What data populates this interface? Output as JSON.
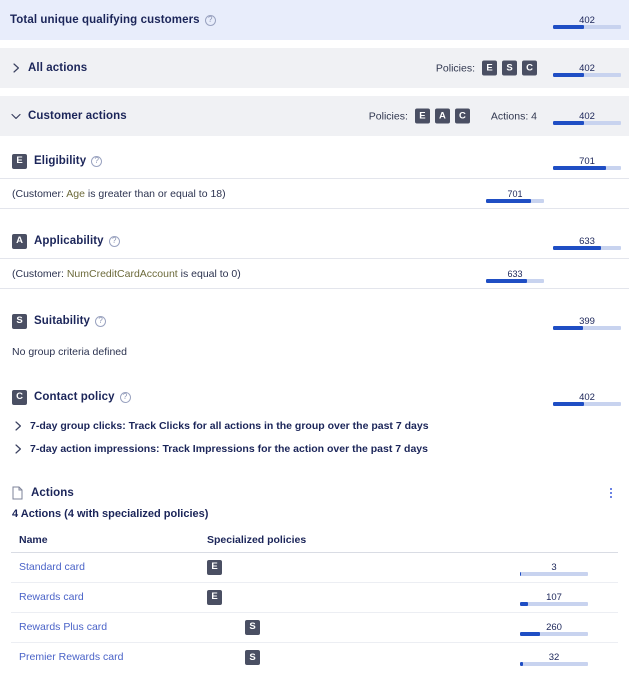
{
  "colors": {
    "accent": "#1f4ec4",
    "track": "#c8d3ef",
    "badge": "#4a4f63",
    "total_band": "#e8edfb",
    "gray_band": "#f0f1f4",
    "link": "#4a63c8"
  },
  "total": {
    "label": "Total unique qualifying customers",
    "help_icon": "question-circle-icon",
    "value": "402",
    "percent": 45
  },
  "all_actions": {
    "label": "All actions",
    "chevron": "chevron-right-icon",
    "policies_label": "Policies:",
    "badges": [
      "E",
      "S",
      "C"
    ],
    "value": "402",
    "percent": 45
  },
  "customer_actions": {
    "label": "Customer actions",
    "chevron": "chevron-down-icon",
    "policies_label": "Policies:",
    "badges": [
      "E",
      "A",
      "C"
    ],
    "actions_count": "Actions: 4",
    "value": "402",
    "percent": 45
  },
  "policy_sections": [
    {
      "badge": "E",
      "title": "Eligibility",
      "help_icon": "question-circle-icon",
      "value": "701",
      "percent": 78,
      "criteria": [
        {
          "text_pre": "(Customer: ",
          "text_hl": "Age",
          "text_post": " is greater than or equal to 18)",
          "value": "701",
          "percent": 78
        }
      ],
      "empty_text": ""
    },
    {
      "badge": "A",
      "title": "Applicability",
      "help_icon": "question-circle-icon",
      "value": "633",
      "percent": 70,
      "criteria": [
        {
          "text_pre": "(Customer: ",
          "text_hl": "NumCreditCardAccount",
          "text_post": " is equal to 0)",
          "value": "633",
          "percent": 70
        }
      ],
      "empty_text": ""
    },
    {
      "badge": "S",
      "title": "Suitability",
      "help_icon": "question-circle-icon",
      "value": "399",
      "percent": 44,
      "criteria": [],
      "empty_text": "No group criteria defined"
    }
  ],
  "contact_policy": {
    "badge": "C",
    "title": "Contact policy",
    "help_icon": "question-circle-icon",
    "value": "402",
    "percent": 45,
    "rows": [
      {
        "chevron": "chevron-right-icon",
        "text": "7-day group clicks: Track Clicks for all actions in the group over the past 7 days"
      },
      {
        "chevron": "chevron-right-icon",
        "text": "7-day action impressions: Track Impressions for the action over the past 7 days"
      }
    ]
  },
  "actions_panel": {
    "icon": "document-icon",
    "title": "Actions",
    "menu_icon": "kebab-menu-icon",
    "summary": "4 Actions (4 with specialized policies)",
    "columns": [
      "Name",
      "Specialized policies"
    ],
    "rows": [
      {
        "name": "Standard card",
        "policy": "E",
        "policy_indent": 0,
        "value": "3",
        "percent": 1
      },
      {
        "name": "Rewards card",
        "policy": "E",
        "policy_indent": 0,
        "value": "107",
        "percent": 12
      },
      {
        "name": "Rewards Plus card",
        "policy": "S",
        "policy_indent": 38,
        "value": "260",
        "percent": 30
      },
      {
        "name": "Premier Rewards card",
        "policy": "S",
        "policy_indent": 38,
        "value": "32",
        "percent": 4
      }
    ]
  }
}
